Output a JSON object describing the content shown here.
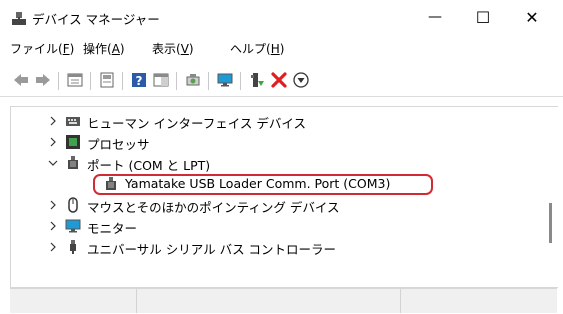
{
  "window": {
    "title": "デバイス マネージャー",
    "controls": {
      "minimize": "—",
      "maximize": "☐",
      "close": "✕"
    }
  },
  "menu": [
    {
      "label": "ファイル(",
      "key": "F",
      "suffix": ")"
    },
    {
      "label": "操作(",
      "key": "A",
      "suffix": ")"
    },
    {
      "label": "表示(",
      "key": "V",
      "suffix": ")"
    },
    {
      "label": "ヘルプ(",
      "key": "H",
      "suffix": ")"
    }
  ],
  "toolbar": {
    "icons": [
      "back-icon",
      "forward-icon",
      "properties-icon",
      "update-driver-icon",
      "help-icon",
      "view-icon",
      "scan-icon",
      "monitor-icon",
      "add-driver-icon",
      "uninstall-icon",
      "disable-icon"
    ]
  },
  "tree": {
    "items": [
      {
        "label": "ヒューマン インターフェイス デバイス",
        "expanded": false,
        "icon": "hid-icon"
      },
      {
        "label": "プロセッサ",
        "expanded": false,
        "icon": "processor-icon"
      },
      {
        "label": "ポート (COM と LPT)",
        "expanded": true,
        "icon": "port-icon"
      },
      {
        "label": "Yamatake USB Loader Comm. Port (COM3)",
        "child": true,
        "selected": true,
        "icon": "port-icon"
      },
      {
        "label": "マウスとそのほかのポインティング デバイス",
        "expanded": false,
        "icon": "mouse-icon"
      },
      {
        "label": "モニター",
        "expanded": false,
        "icon": "monitor-icon"
      },
      {
        "label": "ユニバーサル シリアル バス コントローラー",
        "expanded": false,
        "icon": "usb-icon"
      }
    ]
  },
  "colors": {
    "selection_outline": "#d02a34",
    "uninstall": "#e02020",
    "monitor": "#1e9bd7"
  }
}
